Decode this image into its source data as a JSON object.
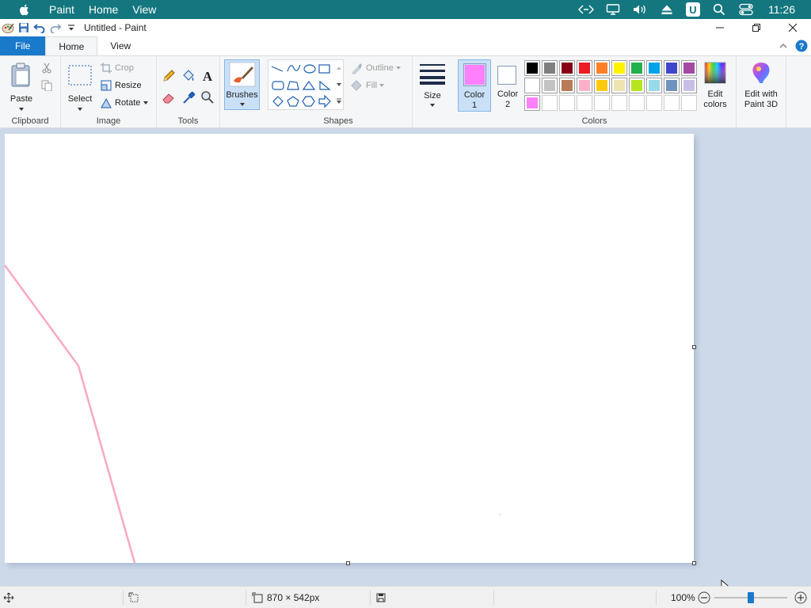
{
  "sysbar": {
    "menus": [
      "Paint",
      "Home",
      "View"
    ],
    "clock": "11:26",
    "icons": [
      "apple-icon",
      "code-icon",
      "display-icon",
      "volume-icon",
      "eject-icon",
      "u-icon",
      "search-icon",
      "control-center-icon"
    ]
  },
  "titlebar": {
    "title": "Untitled - Paint"
  },
  "tabs": {
    "file": "File",
    "home": "Home",
    "view": "View"
  },
  "ribbon": {
    "clipboard": {
      "label": "Clipboard",
      "paste": "Paste"
    },
    "image": {
      "label": "Image",
      "select": "Select",
      "crop": "Crop",
      "resize": "Resize",
      "rotate": "Rotate"
    },
    "tools": {
      "label": "Tools"
    },
    "brushes": {
      "label": "Brushes"
    },
    "shapes": {
      "label": "Shapes",
      "outline": "Outline",
      "fill": "Fill"
    },
    "size": {
      "label": "Size"
    },
    "colors": {
      "label": "Colors",
      "color1": "Color 1",
      "color1_line1": "Color",
      "color1_line2": "1",
      "color2_line1": "Color",
      "color2_line2": "2",
      "color1_value": "#ff80ff",
      "color2_value": "#ffffff",
      "edit_colors_line1": "Edit",
      "edit_colors_line2": "colors",
      "paint3d_line1": "Edit with",
      "paint3d_line2": "Paint 3D",
      "palette_row1": [
        "#000000",
        "#7f7f7f",
        "#880015",
        "#ed1c24",
        "#ff7f27",
        "#fff200",
        "#22b14c",
        "#00a2e8",
        "#3f48cc",
        "#a349a4"
      ],
      "palette_row2": [
        "#ffffff",
        "#c3c3c3",
        "#b97a57",
        "#ffaec9",
        "#ffc90e",
        "#efe4b0",
        "#b5e61d",
        "#99d9ea",
        "#7092be",
        "#c8bfe7"
      ],
      "palette_row3": [
        "#ff80ff",
        "",
        "",
        "",
        "",
        "",
        "",
        "",
        "",
        ""
      ]
    }
  },
  "statusbar": {
    "image_size": "870 × 542px",
    "zoom": "100%",
    "zoom_fraction": 0.5
  }
}
